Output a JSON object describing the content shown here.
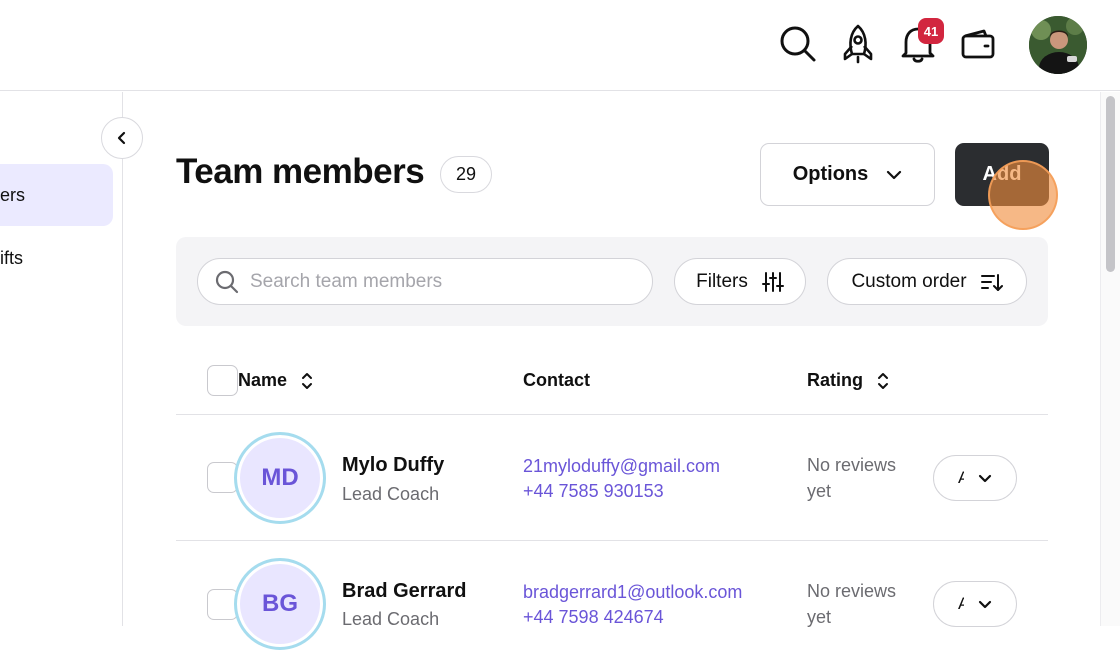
{
  "topbar": {
    "icons": [
      "search-icon",
      "rocket-icon",
      "bell-icon",
      "wallet-icon"
    ],
    "notification_count": "41"
  },
  "sidebar": {
    "items": [
      {
        "label": "ers",
        "active": true
      },
      {
        "label": "ifts",
        "active": false
      }
    ]
  },
  "page": {
    "title": "Team members",
    "count": "29",
    "options_label": "Options",
    "add_label": "Add"
  },
  "filters": {
    "search_placeholder": "Search team members",
    "filters_label": "Filters",
    "order_label": "Custom order"
  },
  "table": {
    "headers": {
      "name": "Name",
      "contact": "Contact",
      "rating": "Rating"
    },
    "rows": [
      {
        "initials": "MD",
        "name": "Mylo Duffy",
        "role": "Lead Coach",
        "email": "21myloduffy@gmail.com",
        "phone": "+44 7585 930153",
        "rating_line1": "No reviews",
        "rating_line2": "yet",
        "action": "A"
      },
      {
        "initials": "BG",
        "name": "Brad Gerrard",
        "role": "Lead Coach",
        "email": "bradgerrard1@outlook.com",
        "phone": "+44 7598 424674",
        "rating_line1": "No reviews",
        "rating_line2": "yet",
        "action": "A"
      }
    ]
  },
  "colors": {
    "accent": "#6a55d8",
    "badge": "#d2263f",
    "add_button": "#2b2d30",
    "active_nav": "#ebeaff"
  }
}
